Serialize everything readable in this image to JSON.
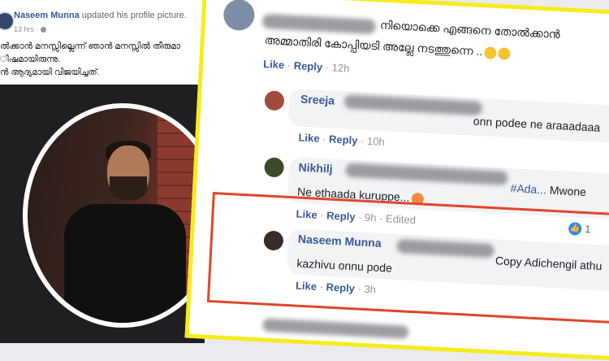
{
  "post": {
    "author": "Naseem Munna",
    "action": "updated his profile picture.",
    "time": "13 hrs ·",
    "caption_lines": [
      "ൽക്കാൻ മനസ്സില്ലെന്ന് ഞാൻ മനസ്സിൽ തീരുമാ",
      "ിഷമായിരുന്നു.",
      "ൻ ആദ്യമായി വിജയിച്ചത്."
    ]
  },
  "comments": [
    {
      "text": "നിയൊക്കെ എങ്ങനെ തോൽക്കാൻ",
      "text2": "അമ്മാതിരി കോപ്പിയടി അല്ലേ നടത്തുന്നെ ..",
      "like": "Like",
      "reply": "Reply",
      "sep": "·",
      "time": "12h"
    },
    {
      "name_fragment": "Sreeja",
      "text": "onn podee ne araaadaaa",
      "like": "Like",
      "reply": "Reply",
      "sep": "·",
      "time": "10h"
    },
    {
      "name_fragment": "Nikhilj",
      "hashtag": "#Ada...",
      "text_after": "Mwone",
      "text": "Ne ethaada kuruppe...",
      "like": "Like",
      "reply": "Reply",
      "sep": "·",
      "time": "9h",
      "edited": "· Edited",
      "reactions": "1"
    },
    {
      "name": "Naseem Munna",
      "text_after": "Copy Adichengil athu",
      "text": "kazhivu onnu pode",
      "like": "Like",
      "reply": "Reply",
      "sep": "·",
      "time": "3h"
    }
  ],
  "colors": {
    "highlight_yellow": "#f6ec1c",
    "highlight_red": "#e0462b",
    "fb_link": "#385898"
  }
}
